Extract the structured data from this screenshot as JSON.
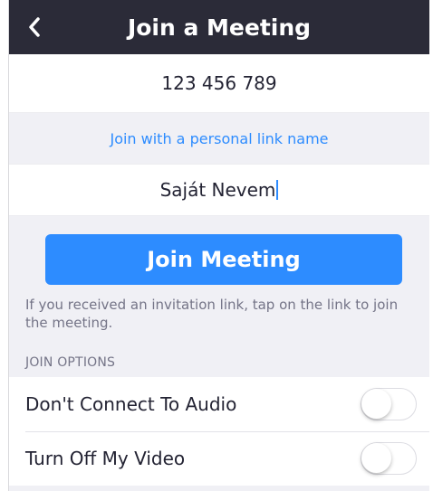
{
  "header": {
    "title": "Join a Meeting",
    "back_icon": "chevron-left-icon"
  },
  "form": {
    "meeting_id_value": "123 456 789",
    "personal_link_label": "Join with a personal link name",
    "name_value": "Saját Nevem"
  },
  "join_button_label": "Join Meeting",
  "hint_text": "If you received an invitation link, tap on the link to join the meeting.",
  "options": {
    "section_title": "JOIN OPTIONS",
    "items": [
      {
        "label": "Don't Connect To Audio",
        "enabled": false
      },
      {
        "label": "Turn Off My Video",
        "enabled": false
      }
    ]
  },
  "colors": {
    "nav_bg": "#2b2b38",
    "accent": "#2d8cff",
    "page_bg": "#f0f0f5"
  }
}
